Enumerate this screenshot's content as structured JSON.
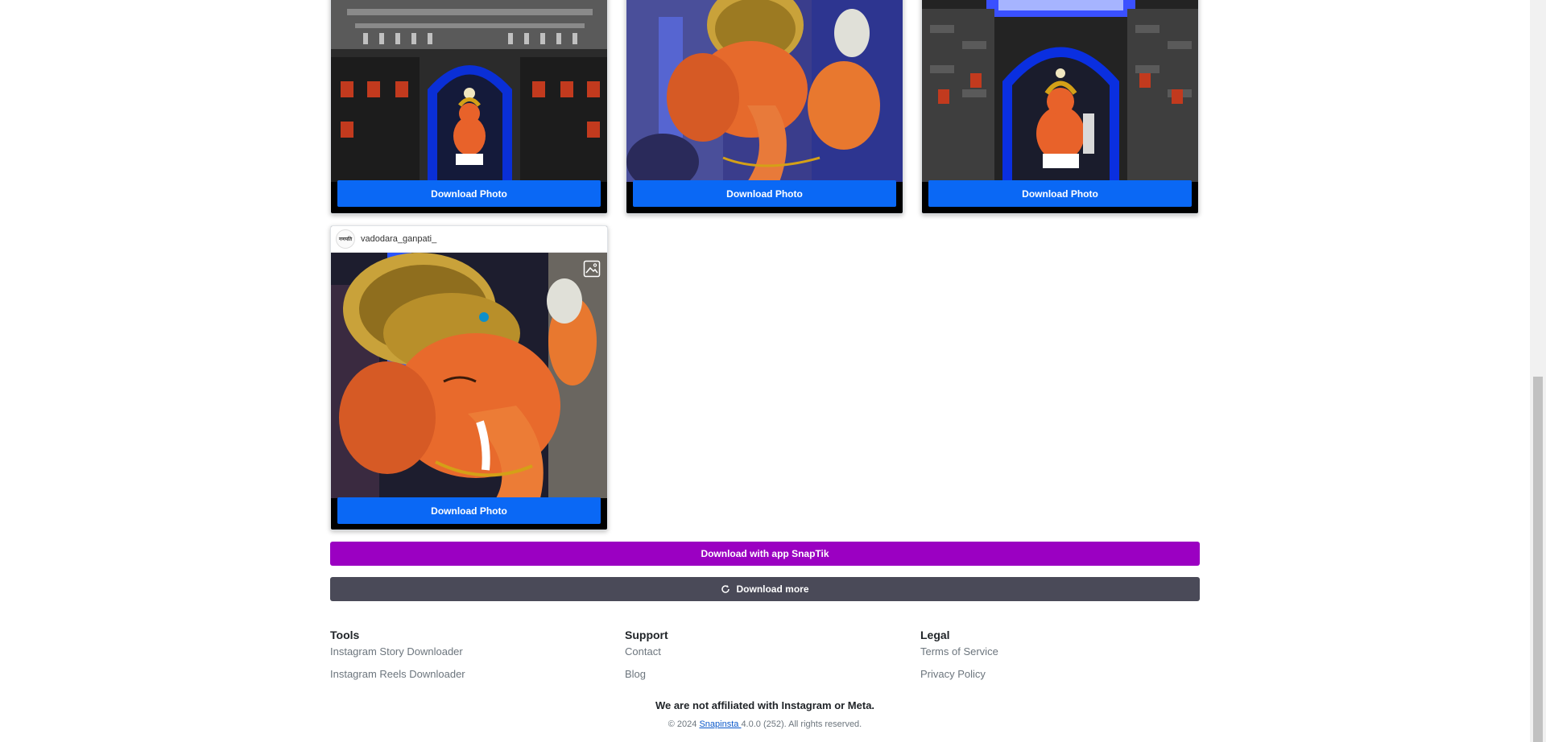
{
  "cards": [
    {
      "button_label": "Download Photo"
    },
    {
      "button_label": "Download Photo"
    },
    {
      "button_label": "Download Photo"
    },
    {
      "username": "vadodara_ganpati_",
      "avatar_text": "गणपति",
      "button_label": "Download Photo"
    }
  ],
  "actions": {
    "snaptik_label": "Download with app SnapTik",
    "more_label": "Download more"
  },
  "footer": {
    "tools": {
      "heading": "Tools",
      "links": [
        "Instagram Story Downloader",
        "Instagram Reels Downloader"
      ]
    },
    "support": {
      "heading": "Support",
      "links": [
        "Contact",
        "Blog"
      ]
    },
    "legal": {
      "heading": "Legal",
      "links": [
        "Terms of Service",
        "Privacy Policy"
      ]
    },
    "disclaimer": "We are not affiliated with Instagram or Meta.",
    "copyright_prefix": "© 2024 ",
    "copyright_link": "Snapinsta ",
    "copyright_suffix": "4.0.0 (252). All rights reserved."
  },
  "colors": {
    "download_button": "#0a68f5",
    "snaptik_button": "#9b00c2",
    "more_button": "#4a4a58"
  }
}
